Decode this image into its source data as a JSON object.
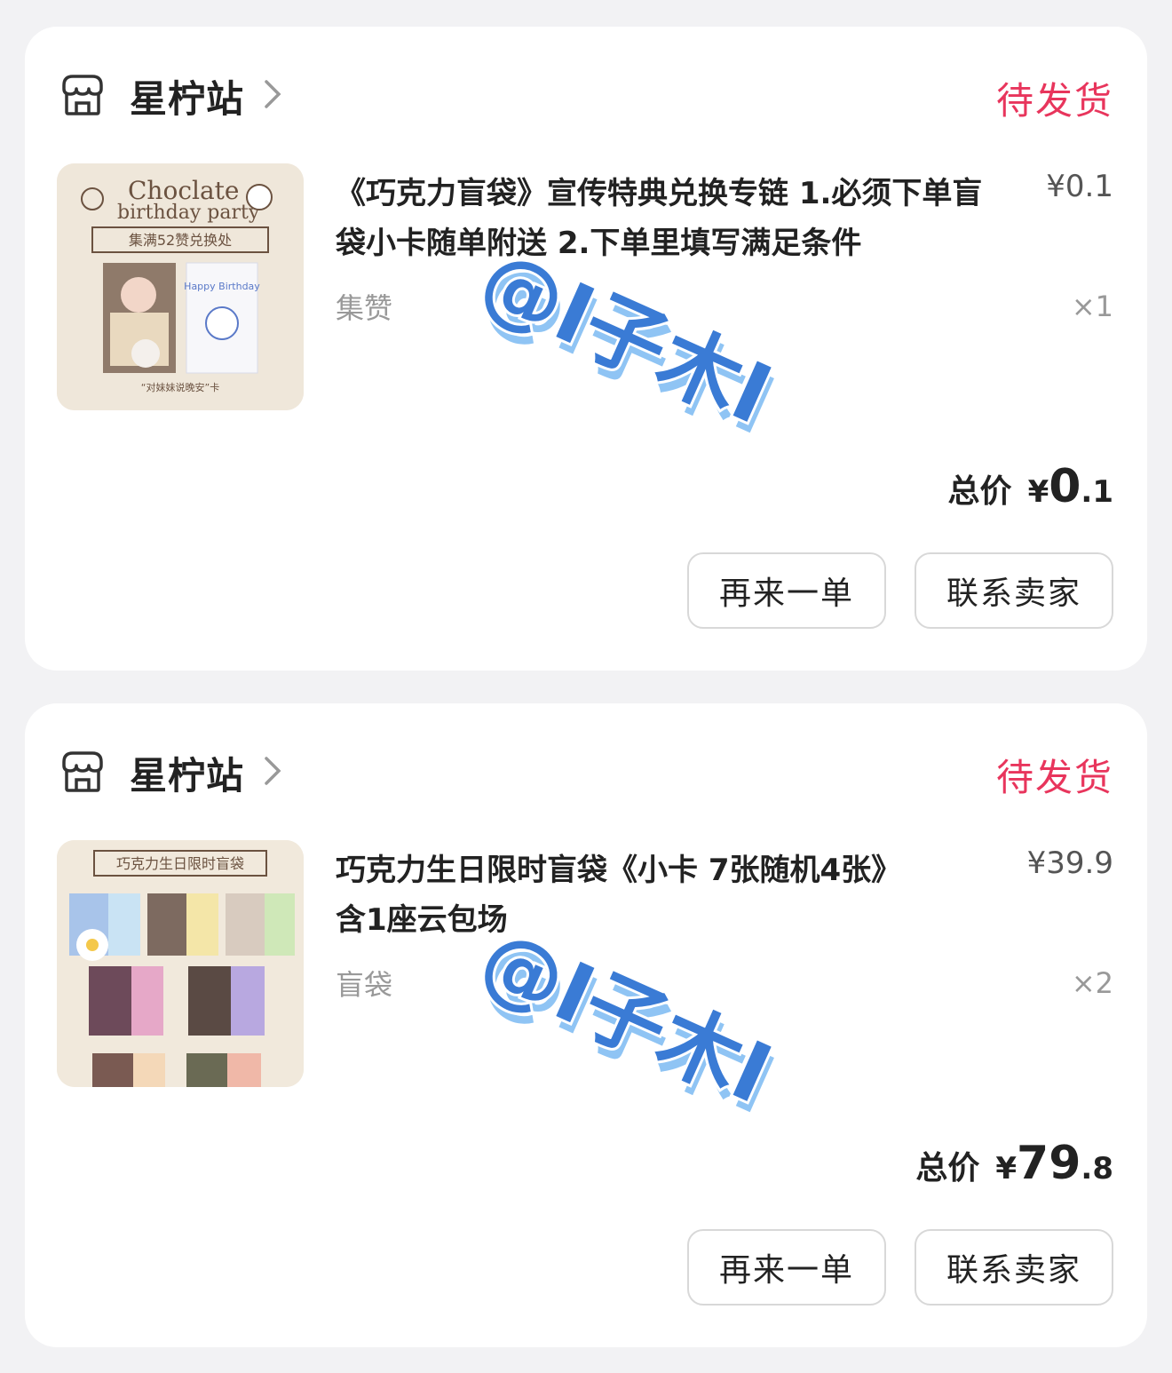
{
  "orders": [
    {
      "shop": {
        "name": "星柠站",
        "icon": "shop-icon"
      },
      "status": "待发货",
      "product": {
        "title": "《巧克力盲袋》宣传特典兑换专链 1.必须下单盲袋小卡随单附送 2.下单里填写满足条件",
        "price": "¥0.1",
        "sku": "集赞",
        "quantity": "×1",
        "thumb": {
          "line1": "Choclate",
          "line2": "birthday party",
          "banner": "集满52赞兑换处",
          "card_text": "Happy Birthday",
          "caption": "“对妹妹说晚安”卡"
        }
      },
      "total": {
        "label": "总价",
        "currency": "¥",
        "int": "0",
        "dec": ".1"
      },
      "buttons": {
        "rebuy": "再来一单",
        "contact": "联系卖家"
      }
    },
    {
      "shop": {
        "name": "星柠站",
        "icon": "shop-icon"
      },
      "status": "待发货",
      "product": {
        "title": "巧克力生日限时盲袋《小卡 7张随机4张》含1座云包场",
        "price": "¥39.9",
        "sku": "盲袋",
        "quantity": "×2",
        "thumb": {
          "banner": "巧克力生日限时盲袋"
        }
      },
      "total": {
        "label": "总价",
        "currency": "¥",
        "int": "79",
        "dec": ".8"
      },
      "buttons": {
        "rebuy": "再来一单",
        "contact": "联系卖家"
      }
    }
  ],
  "watermark": "@I子木I",
  "colors": {
    "status": "#e8355c",
    "watermark_fill": "#3a7bd5",
    "watermark_shadow": "#8fc4f4"
  }
}
